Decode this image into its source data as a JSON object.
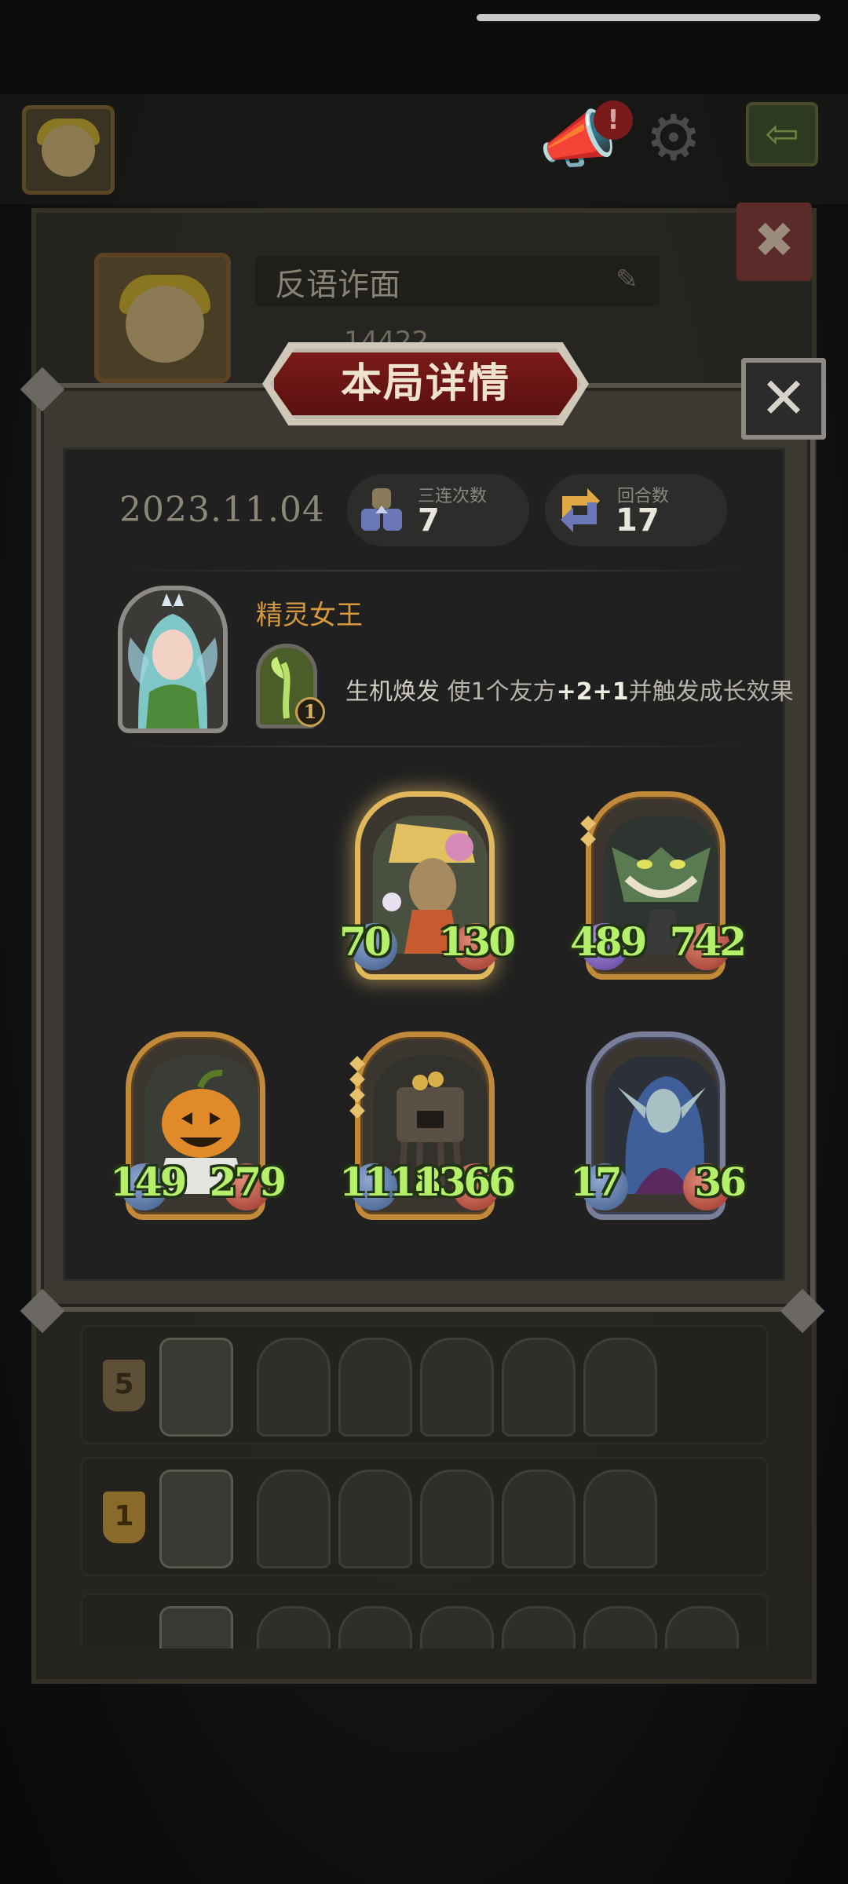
{
  "hud": {
    "notice_badge": "!",
    "back_icon": "arrow-left-icon",
    "settings_icon": "gear-icon",
    "announce_icon": "megaphone-icon"
  },
  "profile": {
    "name": "反语诈面",
    "score": "14422"
  },
  "modal": {
    "title": "本局详情",
    "date": "2023.11.04",
    "triples_label": "三连次数",
    "triples_value": "7",
    "rounds_label": "回合数",
    "rounds_value": "17"
  },
  "hero": {
    "name": "精灵女王",
    "skill_level": "1",
    "skill_name": "生机焕发",
    "skill_text_1": "使1个友方",
    "skill_bonus": "+2+1",
    "skill_text_2": "并触发成长效果"
  },
  "minions": [
    {
      "id": "scarecrow-flower-girl",
      "attack": "70",
      "health": "130",
      "frame": "golden"
    },
    {
      "id": "goblin-beast",
      "attack": "489",
      "health": "742",
      "frame": "gold"
    },
    {
      "id": "pumpkin-head",
      "attack": "149",
      "health": "279",
      "frame": "gold"
    },
    {
      "id": "box-golem",
      "attack": "1118",
      "health": "1366",
      "frame": "gold"
    },
    {
      "id": "dark-elf-sorceress",
      "attack": "17",
      "health": "36",
      "frame": "purple"
    }
  ],
  "team_rows": [
    {
      "rank": "5"
    },
    {
      "rank": "1"
    }
  ],
  "colors": {
    "accent_gold": "#d6983e",
    "stat_green": "#b4f06a",
    "title_red": "#7a1a18"
  }
}
